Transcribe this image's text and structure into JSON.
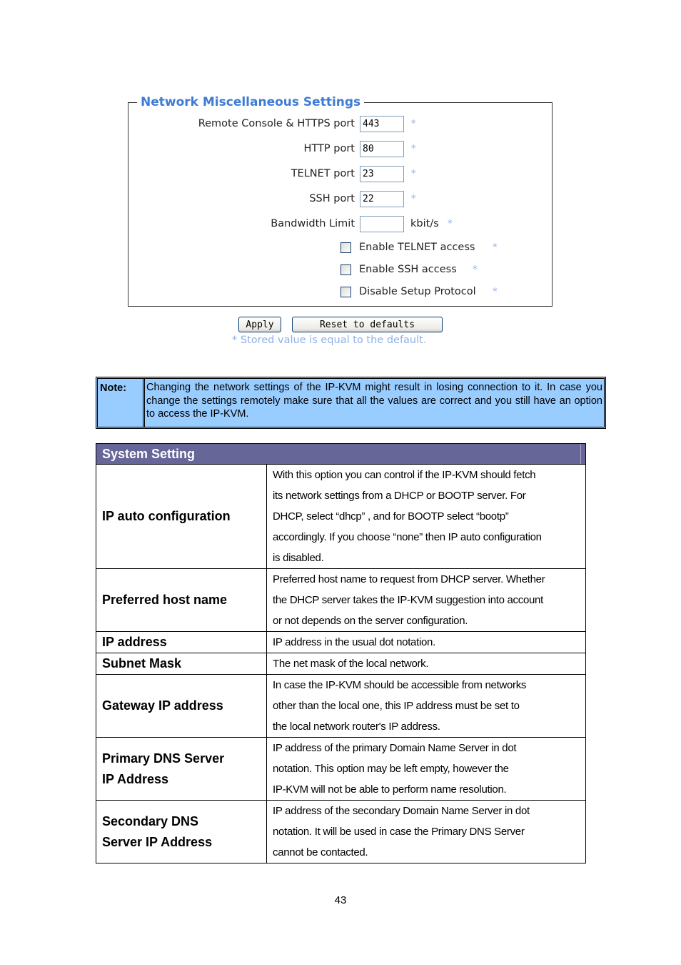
{
  "panel": {
    "title": "Network Miscellaneous Settings",
    "fields": [
      {
        "label": "Remote Console & HTTPS port",
        "value": "443",
        "marker": "*"
      },
      {
        "label": "HTTP port",
        "value": "80",
        "marker": "*"
      },
      {
        "label": "TELNET port",
        "value": "23",
        "marker": "*"
      },
      {
        "label": "SSH port",
        "value": "22",
        "marker": "*"
      },
      {
        "label": "Bandwidth Limit",
        "value": "",
        "unit": "kbit/s",
        "marker": "*"
      }
    ],
    "checkboxes": [
      {
        "label": "Enable TELNET access",
        "checked": false,
        "marker": "*"
      },
      {
        "label": "Enable SSH access",
        "checked": false,
        "marker": "*"
      },
      {
        "label": "Disable Setup Protocol",
        "checked": false,
        "marker": "*"
      }
    ],
    "apply_label": "Apply",
    "reset_label": "Reset to defaults",
    "footnote": "* Stored value is equal to the default."
  },
  "note": {
    "label": "Note:",
    "text": "Changing the network settings of the IP-KVM might result in losing connection to it. In case you change the settings remotely make sure that all the values are correct and you still have an option to access the IP-KVM."
  },
  "system_setting": {
    "title": "System Setting",
    "rows": [
      {
        "name": "IP auto configuration",
        "desc": [
          "With this option you can control if the IP-KVM should fetch",
          "its network settings from a DHCP or BOOTP server. For",
          "DHCP, select “dhcp” , and for BOOTP select “bootp”",
          "accordingly. If you choose “none” then IP auto configuration",
          "is disabled."
        ]
      },
      {
        "name": "Preferred host name",
        "desc": [
          "Preferred host name to request from DHCP server. Whether",
          "the DHCP server takes the IP-KVM suggestion into account",
          "or not depends on the server configuration."
        ]
      },
      {
        "name": "IP address",
        "desc": [
          "IP address in the usual dot notation."
        ]
      },
      {
        "name": "Subnet Mask",
        "desc": [
          "The net mask of the local network."
        ]
      },
      {
        "name": "Gateway IP address",
        "desc": [
          "In case the IP-KVM should be accessible from networks",
          "other than the local one, this IP address must be set to",
          "the local network router's IP address."
        ]
      },
      {
        "name": "Primary DNS Server\nIP Address",
        "desc": [
          "IP address of the primary Domain Name Server in dot",
          "notation. This option may be left empty, however the",
          "IP-KVM will not be able to perform name resolution."
        ]
      },
      {
        "name": "Secondary DNS\nServer IP Address",
        "desc": [
          "IP address of the secondary Domain Name Server in dot",
          "notation. It will be used in case the Primary DNS Server",
          "cannot be contacted."
        ]
      }
    ]
  },
  "page_number": "43"
}
